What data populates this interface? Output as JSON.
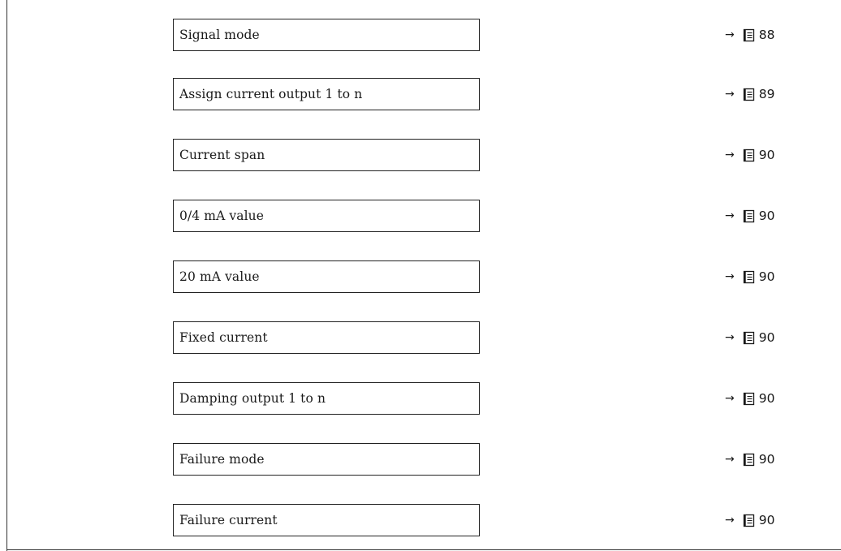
{
  "parameters": [
    {
      "label": "Signal mode",
      "arrow": "→",
      "page": "88",
      "icon": "book-icon"
    },
    {
      "label": "Assign current output 1 to n",
      "arrow": "→",
      "page": "89",
      "icon": "book-icon"
    },
    {
      "label": "Current span",
      "arrow": "→",
      "page": "90",
      "icon": "book-icon"
    },
    {
      "label": "0/4 mA value",
      "arrow": "→",
      "page": "90",
      "icon": "book-icon"
    },
    {
      "label": "20 mA value",
      "arrow": "→",
      "page": "90",
      "icon": "book-icon"
    },
    {
      "label": "Fixed current",
      "arrow": "→",
      "page": "90",
      "icon": "book-icon"
    },
    {
      "label": "Damping output 1 to n",
      "arrow": "→",
      "page": "90",
      "icon": "book-icon"
    },
    {
      "label": "Failure mode",
      "arrow": "→",
      "page": "90",
      "icon": "book-icon"
    },
    {
      "label": "Failure current",
      "arrow": "→",
      "page": "90",
      "icon": "book-icon"
    }
  ]
}
